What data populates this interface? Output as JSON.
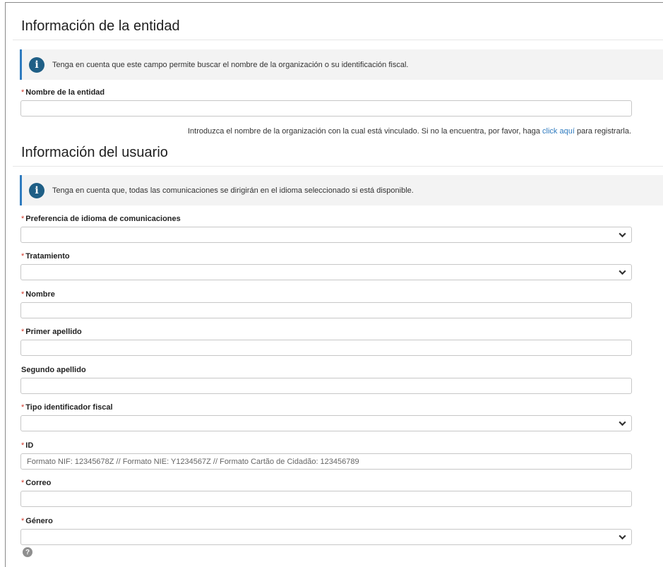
{
  "entity": {
    "title": "Información de la entidad",
    "info": "Tenga en cuenta que este campo permite buscar el nombre de la organización o su identificación fiscal.",
    "name_label": "Nombre de la entidad",
    "name_value": "",
    "help_prefix": "Introduzca el nombre de la organización con la cual está vinculado. Si no la encuentra, por favor, haga ",
    "help_link": "click aquí",
    "help_suffix": " para registrarla."
  },
  "user": {
    "title": "Información del usuario",
    "info": "Tenga en cuenta que, todas las comunicaciones se dirigirán en el idioma seleccionado si está disponible.",
    "fields": {
      "language": {
        "label": "Preferencia de idioma de comunicaciones",
        "required": "*",
        "value": ""
      },
      "treatment": {
        "label": "Tratamiento",
        "required": "*",
        "value": ""
      },
      "first_name": {
        "label": "Nombre",
        "required": "*",
        "value": ""
      },
      "last_name_1": {
        "label": "Primer apellido",
        "required": "*",
        "value": ""
      },
      "last_name_2": {
        "label": "Segundo apellido",
        "value": ""
      },
      "tax_id_type": {
        "label": "Tipo identificador fiscal",
        "required": "*",
        "value": ""
      },
      "id": {
        "label": "ID",
        "required": "*",
        "value": "",
        "placeholder": "Formato NIF: 12345678Z // Formato NIE: Y1234567Z // Formato Cartão de Cidadão: 123456789"
      },
      "email": {
        "label": "Correo",
        "required": "*",
        "value": ""
      },
      "gender": {
        "label": "Género",
        "required": "*",
        "value": ""
      }
    }
  },
  "icons": {
    "info": "info-icon",
    "chevron": "chevron-down-icon",
    "help": "question-circle-icon"
  },
  "colors": {
    "accent": "#2f7bbf",
    "required": "#d0392b",
    "info_icon": "#1f5f86",
    "info_bg": "#f3f3f3"
  }
}
